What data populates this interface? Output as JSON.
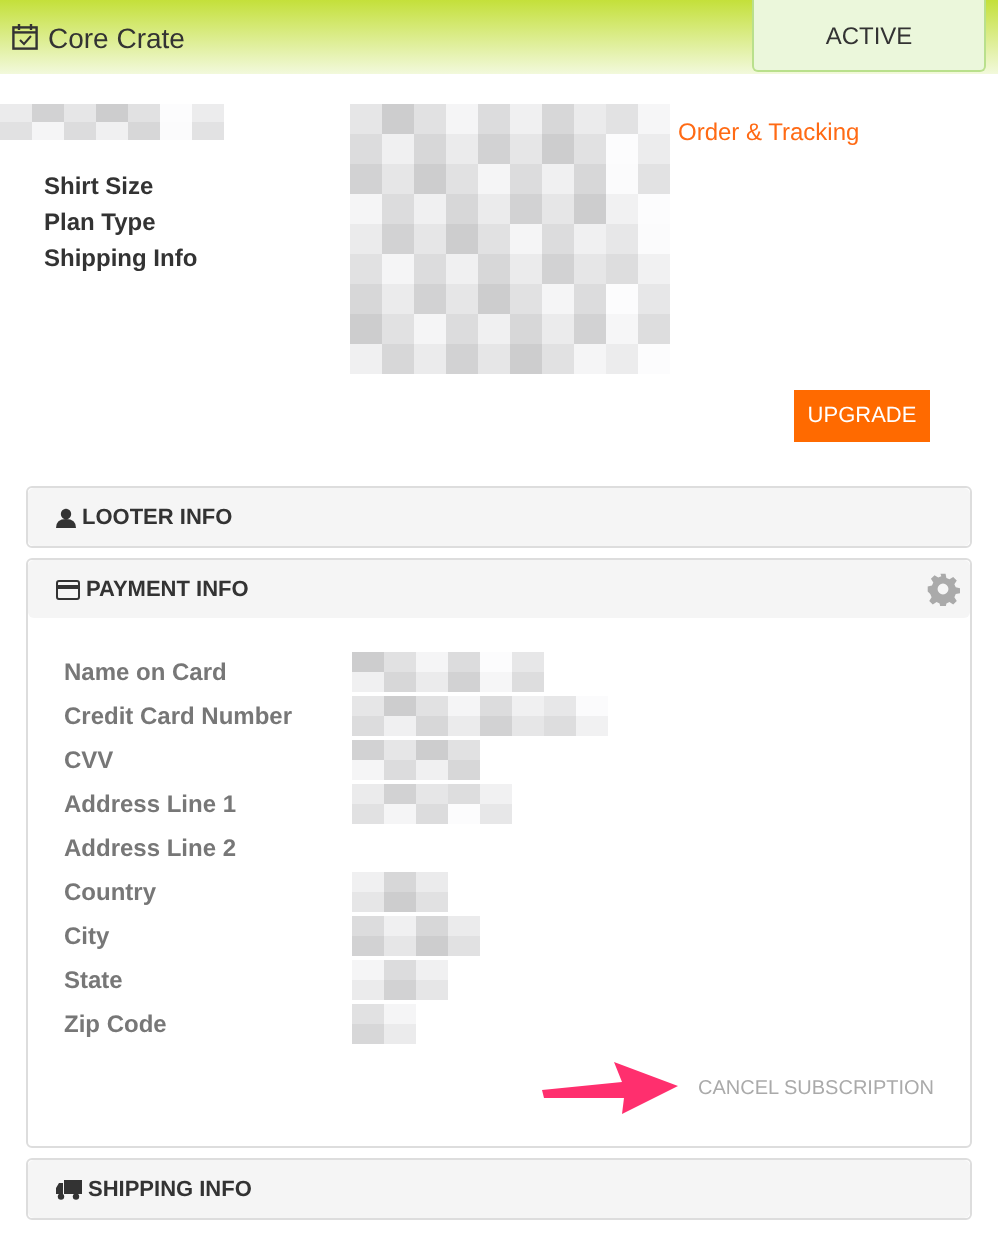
{
  "header": {
    "title": "Core Crate",
    "status": "ACTIVE"
  },
  "subscription": {
    "fields": [
      "Shirt Size",
      "Plan Type",
      "Shipping Info"
    ],
    "link": "Order & Tracking",
    "upgrade_button": "UPGRADE"
  },
  "panels": [
    {
      "title": "LOOTER INFO",
      "kind": "user",
      "expanded": false
    },
    {
      "title": "PAYMENT INFO",
      "kind": "card",
      "expanded": true,
      "settings": true,
      "fields": [
        "Name on Card",
        "Credit Card Number",
        "CVV",
        "Address Line 1",
        "Address Line 2",
        "Country",
        "City",
        "State",
        "Zip Code"
      ],
      "cancel_link": "CANCEL SUBSCRIPTION"
    },
    {
      "title": "SHIPPING INFO",
      "kind": "truck",
      "expanded": false
    }
  ]
}
